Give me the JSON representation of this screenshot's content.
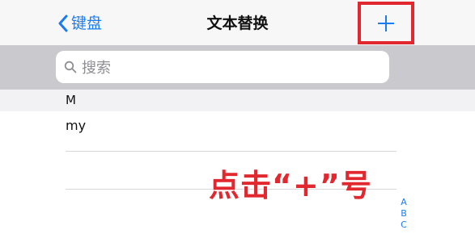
{
  "nav": {
    "back_label": "键盘",
    "title": "文本替换"
  },
  "search": {
    "placeholder": "搜索"
  },
  "list": {
    "section": "M",
    "rows": [
      {
        "text": "my"
      },
      {
        "text": ""
      },
      {
        "text": ""
      }
    ]
  },
  "annotation": "点击“+”号",
  "index": [
    "A",
    "B",
    "C"
  ],
  "colors": {
    "accent": "#1a7cf0",
    "highlight": "#e0282e",
    "search_background": "#c9c9ce"
  },
  "icons": {
    "back": "chevron-left-icon",
    "add": "plus-icon",
    "search": "search-icon"
  }
}
